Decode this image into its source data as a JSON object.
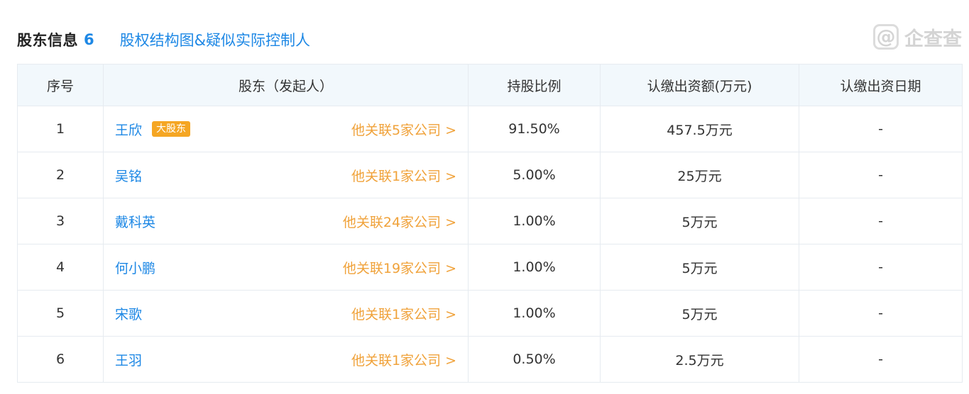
{
  "header": {
    "title": "股东信息",
    "count": "6",
    "equity_link": "股权结构图&疑似实际控制人",
    "logo_text": "企查查",
    "logo_mark": "@"
  },
  "table": {
    "columns": [
      "序号",
      "股东（发起人）",
      "持股比例",
      "认缴出资额(万元)",
      "认缴出资日期"
    ],
    "rows": [
      {
        "no": "1",
        "name": "王欣",
        "badge": "大股东",
        "assoc": "他关联5家公司 >",
        "ratio": "91.50%",
        "amount": "457.5万元",
        "date": "-"
      },
      {
        "no": "2",
        "name": "吴铭",
        "badge": "",
        "assoc": "他关联1家公司 >",
        "ratio": "5.00%",
        "amount": "25万元",
        "date": "-"
      },
      {
        "no": "3",
        "name": "戴科英",
        "badge": "",
        "assoc": "他关联24家公司 >",
        "ratio": "1.00%",
        "amount": "5万元",
        "date": "-"
      },
      {
        "no": "4",
        "name": "何小鹏",
        "badge": "",
        "assoc": "他关联19家公司 >",
        "ratio": "1.00%",
        "amount": "5万元",
        "date": "-"
      },
      {
        "no": "5",
        "name": "宋歌",
        "badge": "",
        "assoc": "他关联1家公司 >",
        "ratio": "1.00%",
        "amount": "5万元",
        "date": "-"
      },
      {
        "no": "6",
        "name": "王羽",
        "badge": "",
        "assoc": "他关联1家公司 >",
        "ratio": "0.50%",
        "amount": "2.5万元",
        "date": "-"
      }
    ]
  },
  "colors": {
    "accent_blue": "#1e88e5",
    "link_orange": "#f0a23a",
    "badge_orange": "#f5a623",
    "header_bg": "#f2f8fc",
    "border": "#e6ebf0"
  }
}
